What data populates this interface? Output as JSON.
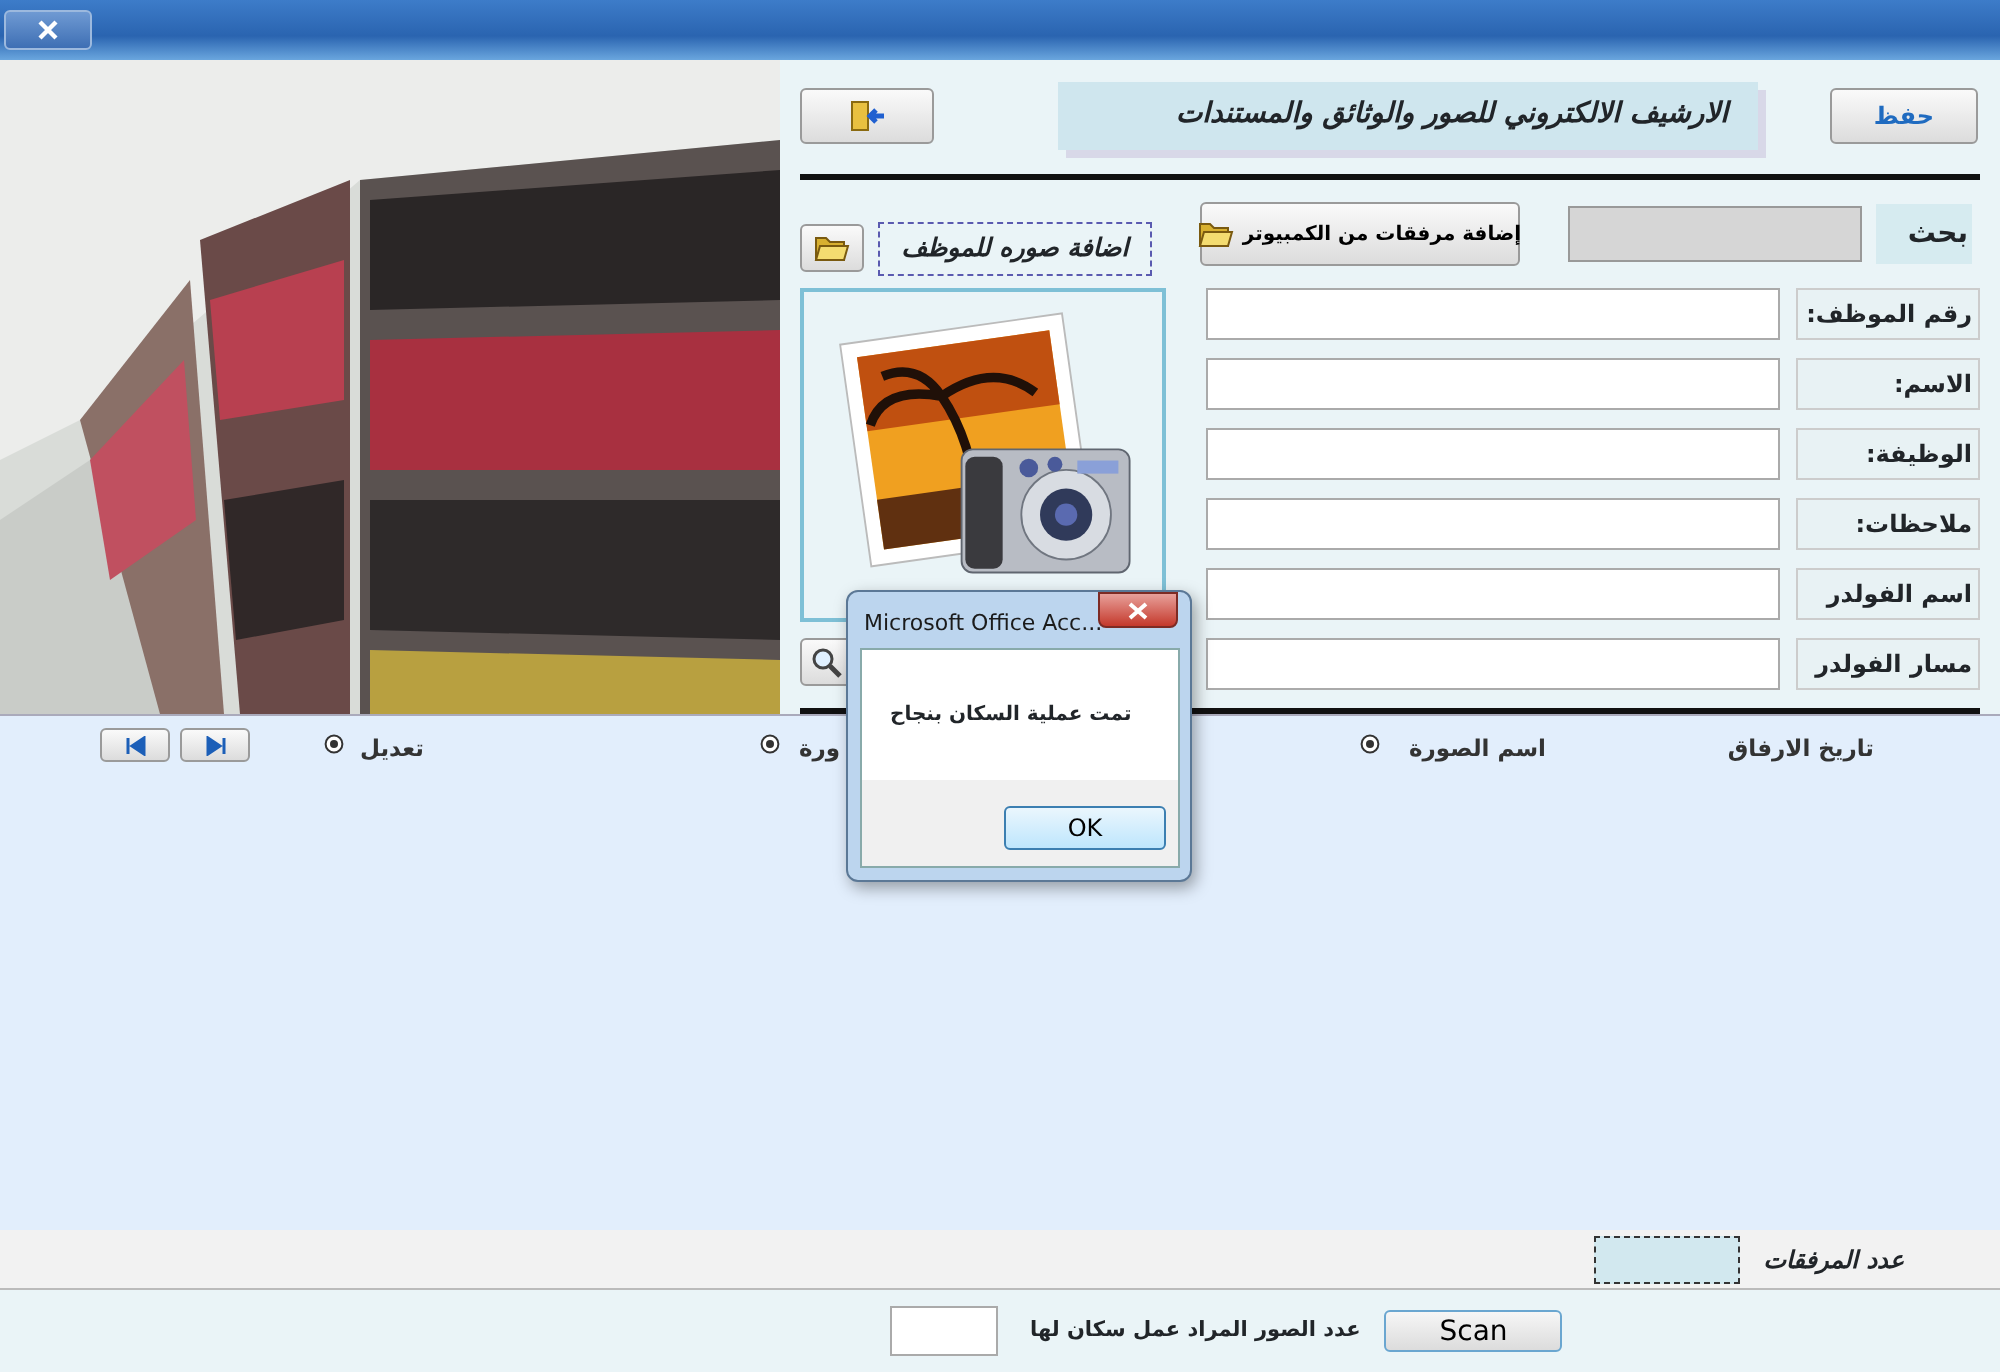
{
  "header": {
    "title": "الارشيف  الالكتروني للصور  والوثائق والمستندات",
    "save_button": "حفظ"
  },
  "toolbar": {
    "add_photo_label": "اضافة صوره للموظف",
    "attach_button": "إضافة مرفقات من الكمبيوتر",
    "search_label": "بحث"
  },
  "fields": [
    {
      "label": "رقم الموظف:"
    },
    {
      "label": "الاسم:"
    },
    {
      "label": "الوظيفة:"
    },
    {
      "label": "ملاحظات:"
    },
    {
      "label": "اسم الفولدر"
    },
    {
      "label": "مسار الفولدر"
    }
  ],
  "list": {
    "columns": [
      {
        "label": "تاريخ الارفاق",
        "kind": "plain"
      },
      {
        "label": "اسم الصورة",
        "kind": "option"
      },
      {
        "label": "ورة",
        "kind": "option"
      },
      {
        "label": "تعديل",
        "kind": "option"
      }
    ]
  },
  "footer": {
    "count_label": "عدد المرفقات",
    "scan_count_label": "عدد الصور المراد عمل سكان لها",
    "scan_button": "Scan"
  },
  "dialog": {
    "title": "Microsoft Office Acc...",
    "message": "تمت عملية السكان بنجاح",
    "ok_button": "OK"
  }
}
